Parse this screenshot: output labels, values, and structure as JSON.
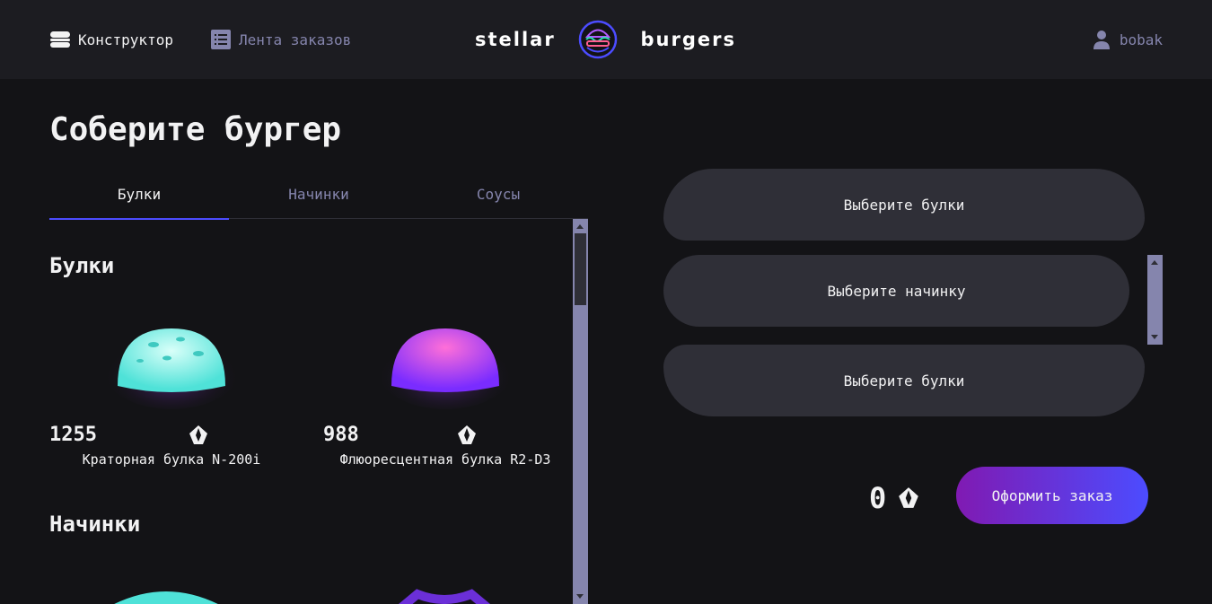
{
  "header": {
    "nav_constructor": "Конструктор",
    "nav_feed": "Лента заказов",
    "logo_left": "stellar",
    "logo_right": "burgers",
    "profile": "bobak"
  },
  "page_title": "Соберите бургер",
  "tabs": [
    {
      "label": "Булки",
      "active": true
    },
    {
      "label": "Начинки",
      "active": false
    },
    {
      "label": "Соусы",
      "active": false
    }
  ],
  "sections": {
    "buns_title": "Булки",
    "fillings_title": "Начинки"
  },
  "ingredients": [
    {
      "name": "Краторная булка N-200i",
      "price": "1255",
      "color": "#7ff0e8"
    },
    {
      "name": "Флюоресцентная булка R2-D3",
      "price": "988",
      "color": "#e04bd8"
    }
  ],
  "constructor": {
    "top_placeholder": "Выберите булки",
    "middle_placeholder": "Выберите начинку",
    "bottom_placeholder": "Выберите булки"
  },
  "order": {
    "total": "0",
    "button": "Оформить заказ"
  },
  "icons": [
    "burger-icon",
    "list-icon",
    "profile-icon",
    "currency-icon"
  ],
  "colors": {
    "accent": "#4c4cff",
    "inactive": "#8585ad",
    "button_start": "#801ab2"
  }
}
